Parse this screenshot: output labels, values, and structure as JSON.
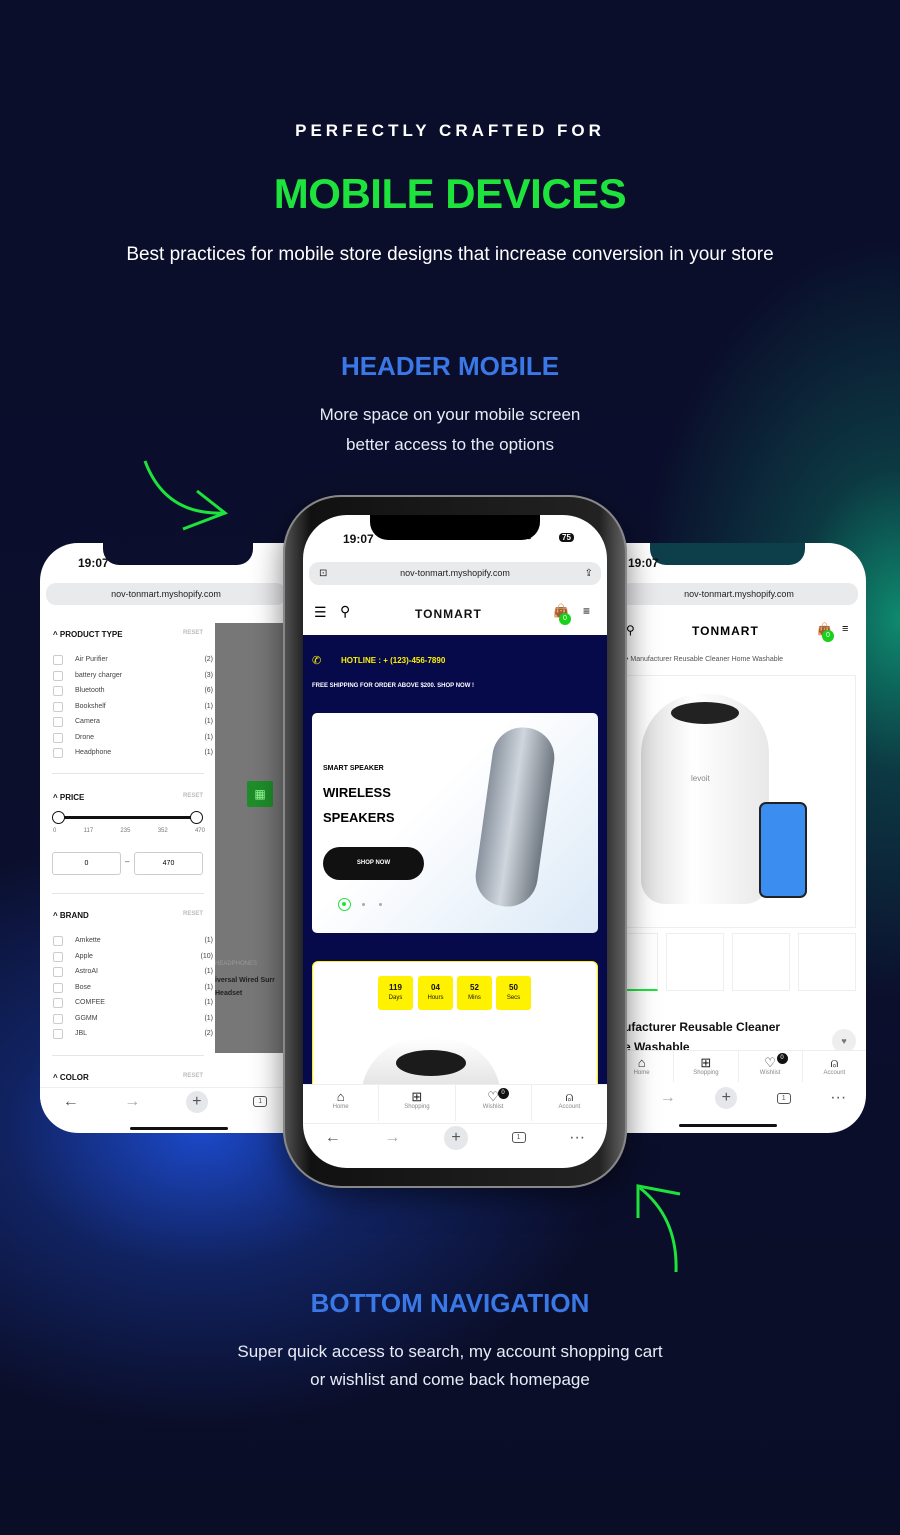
{
  "hero": {
    "kicker": "PERFECTLY CRAFTED FOR",
    "title": "MOBILE DEVICES",
    "subtitle": "Best practices for mobile store designs that increase conversion in your store"
  },
  "section_header": {
    "title": "HEADER MOBILE",
    "line1": "More space on your mobile screen",
    "line2": "better access to the options"
  },
  "section_nav": {
    "title": "BOTTOM NAVIGATION",
    "line1": "Super quick access to search, my account shopping cart",
    "line2": "or wishlist and come back homepage"
  },
  "colors": {
    "accent_green": "#1de33c",
    "heading_blue": "#3a78e8",
    "navy": "#070a4a",
    "yellow": "#fff200"
  },
  "device": {
    "time": "19:07",
    "battery": "75",
    "url": "nov-tonmart.myshopify.com",
    "tabs_count": "1"
  },
  "store": {
    "logo": "TONMART",
    "cart_count": "0",
    "wishlist_count": "0"
  },
  "left_phone": {
    "product_type": {
      "title": "PRODUCT TYPE",
      "reset": "RESET",
      "items": [
        {
          "label": "Air Purifier",
          "count": "(2)"
        },
        {
          "label": "battery charger",
          "count": "(3)"
        },
        {
          "label": "Bluetooth",
          "count": "(6)"
        },
        {
          "label": "Bookshelf",
          "count": "(1)"
        },
        {
          "label": "Camera",
          "count": "(1)"
        },
        {
          "label": "Drone",
          "count": "(1)"
        },
        {
          "label": "Headphone",
          "count": "(1)"
        }
      ]
    },
    "price": {
      "title": "PRICE",
      "reset": "RESET",
      "ticks": [
        "0",
        "117",
        "235",
        "352",
        "470"
      ],
      "min": "0",
      "max": "470",
      "separator": "–"
    },
    "brand": {
      "title": "BRAND",
      "reset": "RESET",
      "items": [
        {
          "label": "Amkette",
          "count": "(1)"
        },
        {
          "label": "Apple",
          "count": "(10)"
        },
        {
          "label": "AstroAI",
          "count": "(1)"
        },
        {
          "label": "Bose",
          "count": "(1)"
        },
        {
          "label": "COMFEE",
          "count": "(1)"
        },
        {
          "label": "GGMM",
          "count": "(1)"
        },
        {
          "label": "JBL",
          "count": "(2)"
        }
      ]
    },
    "color": {
      "title": "COLOR",
      "reset": "RESET"
    },
    "behind": {
      "category": "HEADPHONES",
      "title1": "iversal Wired Surr",
      "title2": "Headset"
    }
  },
  "center_phone": {
    "hotline": "HOTLINE : + (123)-456-7890",
    "shipping": "FREE SHIPPING FOR ORDER ABOVE $200. SHOP NOW !",
    "banner": {
      "eyebrow": "SMART SPEAKER",
      "title1": "WIRELESS",
      "title2": "SPEAKERS",
      "button": "SHOP NOW"
    },
    "countdown": [
      {
        "value": "119",
        "unit": "Days"
      },
      {
        "value": "04",
        "unit": "Hours"
      },
      {
        "value": "52",
        "unit": "Mins"
      },
      {
        "value": "50",
        "unit": "Secs"
      }
    ]
  },
  "right_phone": {
    "breadcrumb": "Manufacturer Reusable Cleaner Home Washable",
    "product_title1": "ufacturer Reusable Cleaner",
    "product_title2": "e Washable",
    "brand_mark": "levoit"
  },
  "bottom_nav": [
    {
      "label": "Home",
      "icon": "home-icon"
    },
    {
      "label": "Shopping",
      "icon": "grid-icon"
    },
    {
      "label": "Wishlist",
      "icon": "heart-icon"
    },
    {
      "label": "Account",
      "icon": "user-icon"
    }
  ]
}
